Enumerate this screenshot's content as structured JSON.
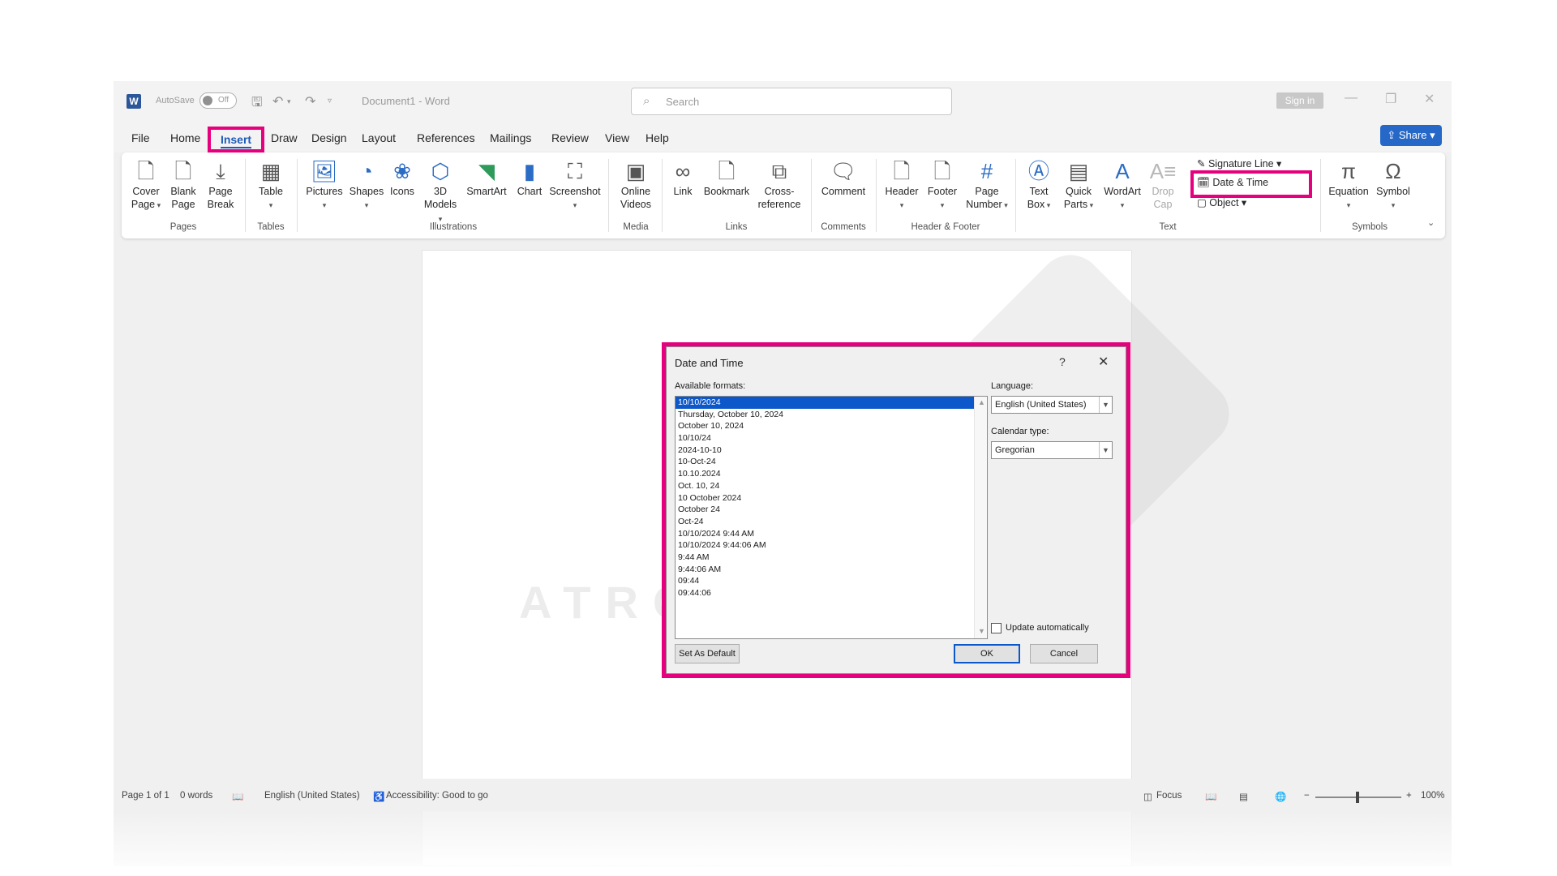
{
  "titlebar": {
    "app_icon": "W",
    "autosave_label": "AutoSave",
    "autosave_state": "Off",
    "doc_title": "Document1  -  Word",
    "search_placeholder": "Search",
    "signin": "Sign in"
  },
  "tabs": [
    "File",
    "Home",
    "Insert",
    "Draw",
    "Design",
    "Layout",
    "References",
    "Mailings",
    "Review",
    "View",
    "Help"
  ],
  "share_label": "Share",
  "ribbon": {
    "pages": {
      "group": "Pages",
      "cover": [
        "Cover",
        "Page"
      ],
      "blank": [
        "Blank",
        "Page"
      ],
      "break": [
        "Page",
        "Break"
      ]
    },
    "tables": {
      "group": "Tables",
      "table": "Table"
    },
    "illustrations": {
      "group": "Illustrations",
      "pictures": "Pictures",
      "shapes": "Shapes",
      "icons": "Icons",
      "models": [
        "3D",
        "Models"
      ],
      "smartart": "SmartArt",
      "chart": "Chart",
      "screenshot": "Screenshot"
    },
    "media": {
      "group": "Media",
      "online_videos": [
        "Online",
        "Videos"
      ]
    },
    "links": {
      "group": "Links",
      "link": "Link",
      "bookmark": "Bookmark",
      "crossref": [
        "Cross-",
        "reference"
      ]
    },
    "comments": {
      "group": "Comments",
      "comment": "Comment"
    },
    "header_footer": {
      "group": "Header & Footer",
      "header": "Header",
      "footer": "Footer",
      "page_number": [
        "Page",
        "Number"
      ]
    },
    "text": {
      "group": "Text",
      "textbox": [
        "Text",
        "Box"
      ],
      "quickparts": [
        "Quick",
        "Parts"
      ],
      "wordart": "WordArt",
      "dropcap": [
        "Drop",
        "Cap"
      ],
      "signature_line": "Signature Line",
      "date_time": "Date & Time",
      "object": "Object"
    },
    "symbols": {
      "group": "Symbols",
      "equation": "Equation",
      "symbol": "Symbol"
    }
  },
  "watermark_text": "ATRO ACADEMY",
  "dialog": {
    "title": "Date and Time",
    "help": "?",
    "close": "✕",
    "available_formats_label": "Available formats:",
    "formats": [
      "10/10/2024",
      "Thursday, October 10, 2024",
      "October 10, 2024",
      "10/10/24",
      "2024-10-10",
      "10-Oct-24",
      "10.10.2024",
      "Oct. 10, 24",
      "10 October 2024",
      "October 24",
      "Oct-24",
      "10/10/2024 9:44 AM",
      "10/10/2024 9:44:06 AM",
      "9:44 AM",
      "9:44:06 AM",
      "09:44",
      "09:44:06"
    ],
    "selected_index": 0,
    "language_label": "Language:",
    "language_value": "English (United States)",
    "calendar_label": "Calendar type:",
    "calendar_value": "Gregorian",
    "update_auto_label": "Update automatically",
    "update_auto_checked": false,
    "set_default": "Set As Default",
    "ok": "OK",
    "cancel": "Cancel"
  },
  "statusbar": {
    "page": "Page 1 of 1",
    "words": "0 words",
    "language": "English (United States)",
    "accessibility": "Accessibility: Good to go",
    "focus": "Focus",
    "zoom": "100%"
  },
  "colors": {
    "highlight": "#e6007e",
    "accent": "#2568c8",
    "selection": "#0c57c9"
  }
}
